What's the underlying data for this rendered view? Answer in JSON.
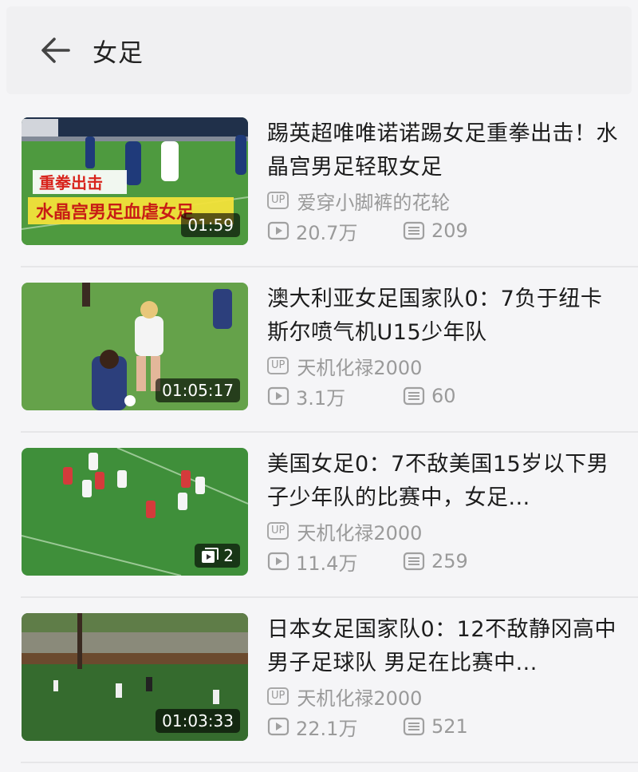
{
  "header": {
    "title": "女足"
  },
  "videos": [
    {
      "title": "踢英超唯唯诺诺踢女足重拳出击！水晶宫男足轻取女足",
      "uploader": "爱穿小脚裤的花轮",
      "views": "20.7万",
      "comments": "209",
      "duration": "01:59",
      "thumb_caption_1": "重拳出击",
      "thumb_caption_2": "水晶宫男足血虐女足"
    },
    {
      "title": "澳大利亚女足国家队0：7负于纽卡斯尔喷气机U15少年队",
      "uploader": "天机化禄2000",
      "views": "3.1万",
      "comments": "60",
      "duration": "01:05:17"
    },
    {
      "title": "美国女足0：7不敌美国15岁以下男子少年队的比赛中，女足...",
      "uploader": "天机化禄2000",
      "views": "11.4万",
      "comments": "259",
      "parts": "2"
    },
    {
      "title": "日本女足国家队0：12不敌静冈高中男子足球队 男足在比赛中...",
      "uploader": "天机化禄2000",
      "views": "22.1万",
      "comments": "521",
      "duration": "01:03:33"
    }
  ],
  "labels": {
    "up_badge": "UP"
  }
}
